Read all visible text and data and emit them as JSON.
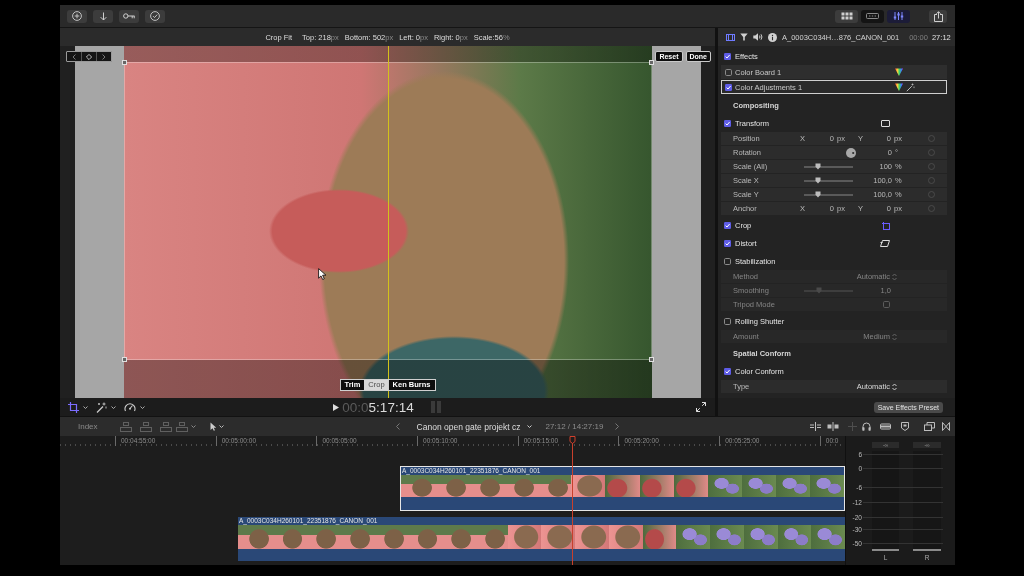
{
  "toolbar": {
    "view_buttons": [
      {
        "shown": false,
        "selected": false
      },
      {
        "shown": true,
        "selected": false
      },
      {
        "shown": true,
        "selected": true
      }
    ]
  },
  "viewer": {
    "mode": "Crop Fit",
    "crop_values": [
      {
        "text": "Top: 218",
        "unit": "px"
      },
      {
        "text": "Bottom: 502",
        "unit": "px"
      },
      {
        "text": "Left: 0",
        "unit": "px"
      },
      {
        "text": "Right: 0",
        "unit": "px"
      },
      {
        "text": "Scale:56",
        "unit": "%"
      }
    ],
    "buttons": [
      "Reset",
      "Done"
    ],
    "modes": [
      {
        "label": "Trim",
        "selected": false
      },
      {
        "label": "Crop",
        "selected": true
      },
      {
        "label": "Ken Burns",
        "selected": false
      }
    ],
    "timecode": {
      "dim": "00:0",
      "value": "5:17:14"
    }
  },
  "inspector": {
    "tabs": [
      {
        "selected": true
      },
      {
        "selected": false
      },
      {
        "selected": false
      },
      {
        "selected": false
      }
    ],
    "clip_name": "A_0003C034H…876_CANON_001",
    "timecode": {
      "dim": "00:00",
      "value": "27:12"
    },
    "sections": [
      {
        "kind": "effects",
        "label": "Effects",
        "checked": true,
        "items": [
          {
            "label": "Color Board 1",
            "checked": false,
            "selected": false
          },
          {
            "label": "Color Adjustments 1",
            "checked": true,
            "selected": true
          }
        ]
      },
      {
        "kind": "heading",
        "label": "Compositing"
      },
      {
        "kind": "effect",
        "label": "Transform",
        "checked": true,
        "rows": [
          {
            "kind": "xy",
            "label": "Position",
            "fields": [
              {
                "axis": "X",
                "value": "0",
                "unit": "px"
              },
              {
                "axis": "Y",
                "value": "0",
                "unit": "px"
              }
            ]
          },
          {
            "kind": "dial",
            "label": "Rotation",
            "value": "0",
            "unit": "°"
          },
          {
            "kind": "slider",
            "label": "Scale (All)",
            "level": 0.28,
            "value": "100",
            "unit": "%"
          },
          {
            "kind": "slider",
            "label": "Scale X",
            "level": 0.28,
            "value": "100,0",
            "unit": "%"
          },
          {
            "kind": "slider",
            "label": "Scale Y",
            "level": 0.28,
            "value": "100,0",
            "unit": "%"
          },
          {
            "kind": "xy",
            "label": "Anchor",
            "fields": [
              {
                "axis": "X",
                "value": "0",
                "unit": "px"
              },
              {
                "axis": "Y",
                "value": "0",
                "unit": "px"
              }
            ]
          }
        ]
      },
      {
        "kind": "effect",
        "label": "Crop",
        "checked": true
      },
      {
        "kind": "effect",
        "label": "Distort",
        "checked": true
      },
      {
        "kind": "effect",
        "label": "Stabilization",
        "checked": false,
        "rows": [
          {
            "kind": "popup",
            "label": "Method",
            "value": "Automatic"
          },
          {
            "kind": "slider",
            "label": "Smoothing",
            "level": 0.3,
            "value": "1,0"
          },
          {
            "kind": "checkbox",
            "label": "Tripod Mode",
            "checked": false
          }
        ]
      },
      {
        "kind": "effect",
        "label": "Rolling Shutter",
        "checked": false,
        "rows": [
          {
            "kind": "popup",
            "label": "Amount",
            "value": "Medium"
          }
        ]
      },
      {
        "kind": "heading",
        "label": "Spatial Conform"
      },
      {
        "kind": "effect",
        "label": "Color Conform",
        "checked": true,
        "rows": [
          {
            "kind": "popup",
            "label": "Type",
            "value": "Automatic"
          }
        ]
      }
    ],
    "save_button": "Save Effects Preset"
  },
  "timeline": {
    "index_button": "Index",
    "project": "Canon open gate projekt cz",
    "duration": "27:12 / 14:27:19",
    "ruler": [
      "00:04:55:00",
      "00:05:00:00",
      "00:05:05:00",
      "00:05:10:00",
      "00:05:15:00",
      "00:05:20:00",
      "00:05:25:00",
      "00:0"
    ],
    "clips": [
      {
        "name": "A_0003C034H260101_22351876_CANON_001",
        "selected": true
      },
      {
        "name": "A_0003C034H260101_22351876_CANON_001",
        "selected": false
      }
    ],
    "meters": {
      "scale": [
        "6",
        "0",
        "-6",
        "-12",
        "-20",
        "-30",
        "-50"
      ],
      "peaks": [
        "-∞",
        "-∞"
      ],
      "channels": [
        "L",
        "R"
      ]
    }
  }
}
